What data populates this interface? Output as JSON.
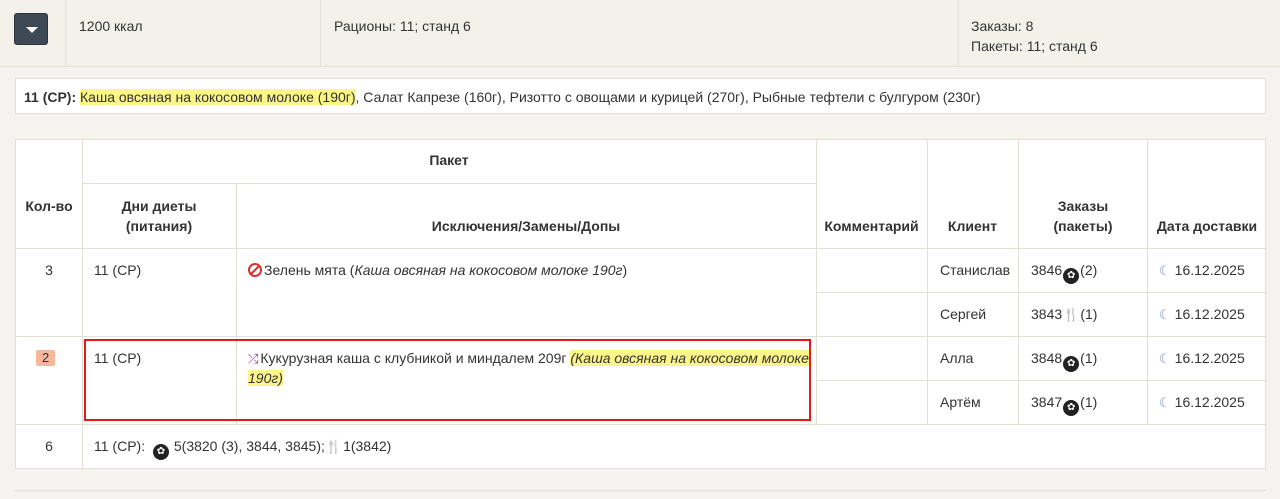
{
  "summary": {
    "calories": "1200 ккал",
    "rations": "Рационы: 11; станд 6",
    "orders": "Заказы: 8",
    "packages": "Пакеты: 11; станд 6"
  },
  "menu": {
    "code": "11 (СР):",
    "highlighted_dish": "Каша овсяная на кокосовом молоке (190г)",
    "other_dishes": ", Салат Капрезе (160г), Ризотто с овощами и курицей (270г), Рыбные тефтели с булгуром (230г)"
  },
  "table": {
    "headers": {
      "qty": "Кол-во",
      "package": "Пакет",
      "diet_days": "Дни диеты (питания)",
      "exclusions": "Исключения/Замены/Допы",
      "comment": "Комментарий",
      "client": "Клиент",
      "orders": "Заказы (пакеты)",
      "delivery_date": "Дата доставки"
    },
    "groups": [
      {
        "qty": "3",
        "diet_days": "11 (СР)",
        "exclusion_text": "Зелень мята",
        "exclusion_note": "Каша овсяная на кокосовом молоке 190г",
        "rows": [
          {
            "client": "Станислав",
            "order": "3846",
            "packages": "(2)",
            "icon": "orders-icon",
            "date": "16.12.2025"
          },
          {
            "client": "Сергей",
            "order": "3843",
            "packages": "(1)",
            "icon": "fork-icon",
            "date": "16.12.2025"
          }
        ]
      },
      {
        "qty": "2",
        "diet_days": "11 (СР)",
        "replacement_text": "Кукурузная каша с клубникой и миндалем 209г",
        "replacement_note_1": "(Каша овсяная на кокосовом молоке",
        "replacement_note_2": "190г)",
        "rows": [
          {
            "client": "Алла",
            "order": "3848",
            "packages": "(1)",
            "icon": "orders-icon",
            "date": "16.12.2025"
          },
          {
            "client": "Артём",
            "order": "3847",
            "packages": "(1)",
            "icon": "orders-icon",
            "date": "16.12.2025"
          }
        ]
      }
    ],
    "total": {
      "qty": "6",
      "prefix": "11 (СР):",
      "orders_part": "5(3820 (3), 3844, 3845);",
      "fork_part": "1(3842)"
    }
  },
  "colors": {
    "highlight": "#fbf58a",
    "badge": "#f6b79a",
    "frame": "#e11b1b"
  }
}
